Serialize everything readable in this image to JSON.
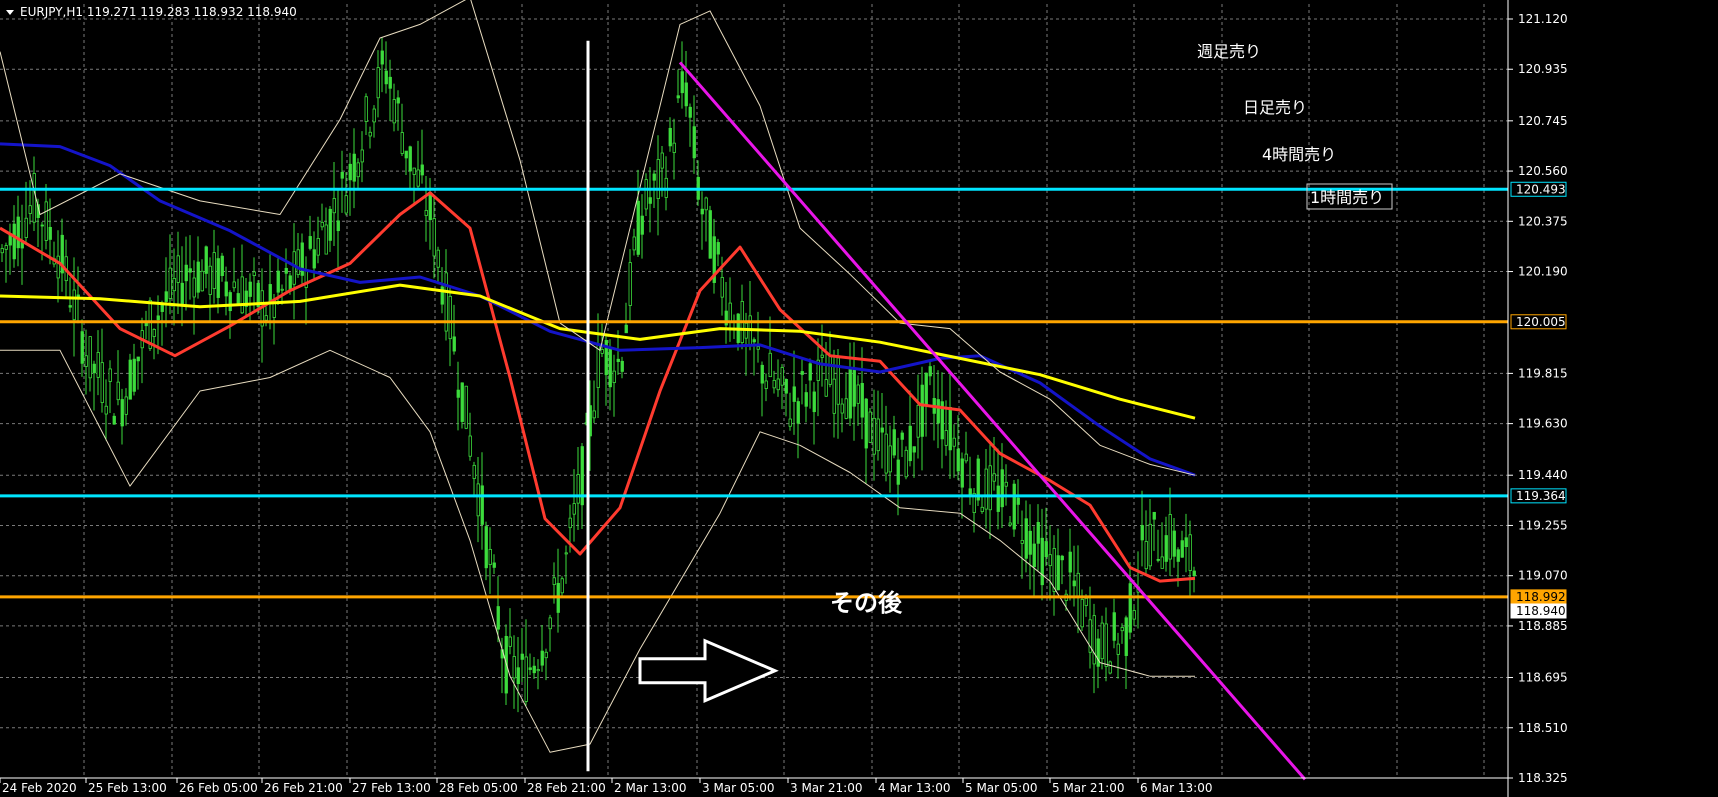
{
  "header": {
    "symbol_line": "EURJPY,H1  119.271 119.283 118.932 118.940"
  },
  "chart_data": {
    "type": "candlestick",
    "symbol": "EURJPY",
    "timeframe": "H1",
    "ohlc_last": {
      "open": 119.271,
      "high": 119.283,
      "low": 118.932,
      "close": 118.94
    },
    "x_axis": {
      "ticks": [
        "24 Feb 2020",
        "25 Feb 13:00",
        "26 Feb 05:00",
        "26 Feb 21:00",
        "27 Feb 13:00",
        "28 Feb 05:00",
        "28 Feb 21:00",
        "2 Mar 13:00",
        "3 Mar 05:00",
        "3 Mar 21:00",
        "4 Mar 13:00",
        "5 Mar 05:00",
        "5 Mar 21:00",
        "6 Mar 13:00"
      ]
    },
    "y_axis": {
      "ticks": [
        121.12,
        120.935,
        120.745,
        120.56,
        120.375,
        120.19,
        119.815,
        119.63,
        119.44,
        119.255,
        119.07,
        118.885,
        118.695,
        118.51,
        118.325
      ],
      "range": [
        118.3,
        121.2
      ]
    },
    "price_tags": [
      {
        "value": 120.493,
        "label": "120.493",
        "color": "#00e5ff",
        "style": "outline"
      },
      {
        "value": 120.005,
        "label": "120.005",
        "color": "#ffa500",
        "style": "outline"
      },
      {
        "value": 119.364,
        "label": "119.364",
        "color": "#00e5ff",
        "style": "outline"
      },
      {
        "value": 118.992,
        "label": "118.992",
        "color": "#ffa500",
        "style": "filled"
      },
      {
        "value": 118.94,
        "label": "118.940",
        "color": "#ffffff",
        "style": "filled"
      }
    ],
    "horizontal_lines": [
      {
        "value": 120.493,
        "color": "#00e5ff",
        "label": "4時間売り"
      },
      {
        "value": 120.005,
        "color": "#ffa500",
        "label": ""
      },
      {
        "value": 119.364,
        "color": "#00e5ff",
        "label": ""
      },
      {
        "value": 118.992,
        "color": "#ffa500",
        "label": ""
      }
    ],
    "annotations": [
      "週足売り",
      "日足売り",
      "4時間売り",
      "1時間売り",
      "その後"
    ],
    "candle_color": "#3ddc3d",
    "series": [
      {
        "name": "",
        "color": "#ff3b2f",
        "type": "ma-fast",
        "points": [
          [
            0,
            120.35
          ],
          [
            60,
            120.22
          ],
          [
            120,
            119.98
          ],
          [
            175,
            119.88
          ],
          [
            230,
            119.99
          ],
          [
            290,
            120.12
          ],
          [
            350,
            120.22
          ],
          [
            400,
            120.4
          ],
          [
            430,
            120.48
          ],
          [
            470,
            120.35
          ],
          [
            510,
            119.8
          ],
          [
            545,
            119.28
          ],
          [
            580,
            119.15
          ],
          [
            620,
            119.32
          ],
          [
            660,
            119.75
          ],
          [
            700,
            120.12
          ],
          [
            740,
            120.28
          ],
          [
            780,
            120.05
          ],
          [
            830,
            119.88
          ],
          [
            880,
            119.86
          ],
          [
            920,
            119.7
          ],
          [
            960,
            119.68
          ],
          [
            1000,
            119.52
          ],
          [
            1050,
            119.42
          ],
          [
            1090,
            119.33
          ],
          [
            1130,
            119.1
          ],
          [
            1160,
            119.05
          ],
          [
            1195,
            119.06
          ]
        ]
      },
      {
        "name": "",
        "color": "#1414c8",
        "type": "ma-mid",
        "points": [
          [
            0,
            120.66
          ],
          [
            60,
            120.65
          ],
          [
            110,
            120.58
          ],
          [
            160,
            120.45
          ],
          [
            230,
            120.34
          ],
          [
            300,
            120.2
          ],
          [
            360,
            120.15
          ],
          [
            420,
            120.17
          ],
          [
            480,
            120.1
          ],
          [
            550,
            119.97
          ],
          [
            620,
            119.9
          ],
          [
            700,
            119.91
          ],
          [
            760,
            119.92
          ],
          [
            820,
            119.85
          ],
          [
            880,
            119.82
          ],
          [
            940,
            119.87
          ],
          [
            980,
            119.88
          ],
          [
            1040,
            119.78
          ],
          [
            1100,
            119.62
          ],
          [
            1150,
            119.5
          ],
          [
            1195,
            119.44
          ]
        ]
      },
      {
        "name": "",
        "color": "#ffff00",
        "type": "ma-slow",
        "points": [
          [
            0,
            120.1
          ],
          [
            100,
            120.09
          ],
          [
            200,
            120.06
          ],
          [
            300,
            120.08
          ],
          [
            400,
            120.14
          ],
          [
            480,
            120.1
          ],
          [
            560,
            119.98
          ],
          [
            640,
            119.94
          ],
          [
            720,
            119.98
          ],
          [
            800,
            119.97
          ],
          [
            880,
            119.93
          ],
          [
            960,
            119.87
          ],
          [
            1040,
            119.81
          ],
          [
            1120,
            119.72
          ],
          [
            1195,
            119.65
          ]
        ]
      },
      {
        "name": "",
        "color": "#e8dcc0",
        "type": "bb-upper",
        "points": [
          [
            0,
            121.0
          ],
          [
            40,
            120.4
          ],
          [
            120,
            120.55
          ],
          [
            200,
            120.45
          ],
          [
            280,
            120.4
          ],
          [
            340,
            120.75
          ],
          [
            380,
            121.05
          ],
          [
            420,
            121.1
          ],
          [
            470,
            121.2
          ],
          [
            520,
            120.6
          ],
          [
            560,
            120.0
          ],
          [
            600,
            119.9
          ],
          [
            640,
            120.5
          ],
          [
            680,
            121.1
          ],
          [
            710,
            121.15
          ],
          [
            760,
            120.8
          ],
          [
            800,
            120.35
          ],
          [
            850,
            120.18
          ],
          [
            900,
            120.0
          ],
          [
            950,
            119.98
          ],
          [
            1000,
            119.82
          ],
          [
            1050,
            119.72
          ],
          [
            1100,
            119.55
          ],
          [
            1150,
            119.48
          ],
          [
            1195,
            119.44
          ]
        ]
      },
      {
        "name": "",
        "color": "#e8dcc0",
        "type": "bb-lower",
        "points": [
          [
            0,
            119.9
          ],
          [
            60,
            119.9
          ],
          [
            130,
            119.4
          ],
          [
            200,
            119.75
          ],
          [
            270,
            119.8
          ],
          [
            330,
            119.9
          ],
          [
            390,
            119.8
          ],
          [
            430,
            119.6
          ],
          [
            470,
            119.2
          ],
          [
            510,
            118.7
          ],
          [
            550,
            118.42
          ],
          [
            590,
            118.45
          ],
          [
            640,
            118.8
          ],
          [
            680,
            119.05
          ],
          [
            720,
            119.3
          ],
          [
            760,
            119.6
          ],
          [
            800,
            119.55
          ],
          [
            850,
            119.45
          ],
          [
            900,
            119.32
          ],
          [
            960,
            119.3
          ],
          [
            1000,
            119.2
          ],
          [
            1050,
            119.05
          ],
          [
            1100,
            118.75
          ],
          [
            1150,
            118.7
          ],
          [
            1195,
            118.7
          ]
        ]
      }
    ],
    "trendlines": [
      {
        "name": "",
        "color": "#e815e8",
        "from": [
          680,
          120.96
        ],
        "to": [
          1305,
          118.32
        ]
      },
      {
        "name": "",
        "color": "#ffffff",
        "from": [
          588,
          121.04
        ],
        "to": [
          588,
          118.35
        ]
      }
    ],
    "arrow": {
      "from": [
        640,
        118.72
      ],
      "to": [
        775,
        118.72
      ],
      "color": "#ffffff"
    },
    "grid": true
  }
}
